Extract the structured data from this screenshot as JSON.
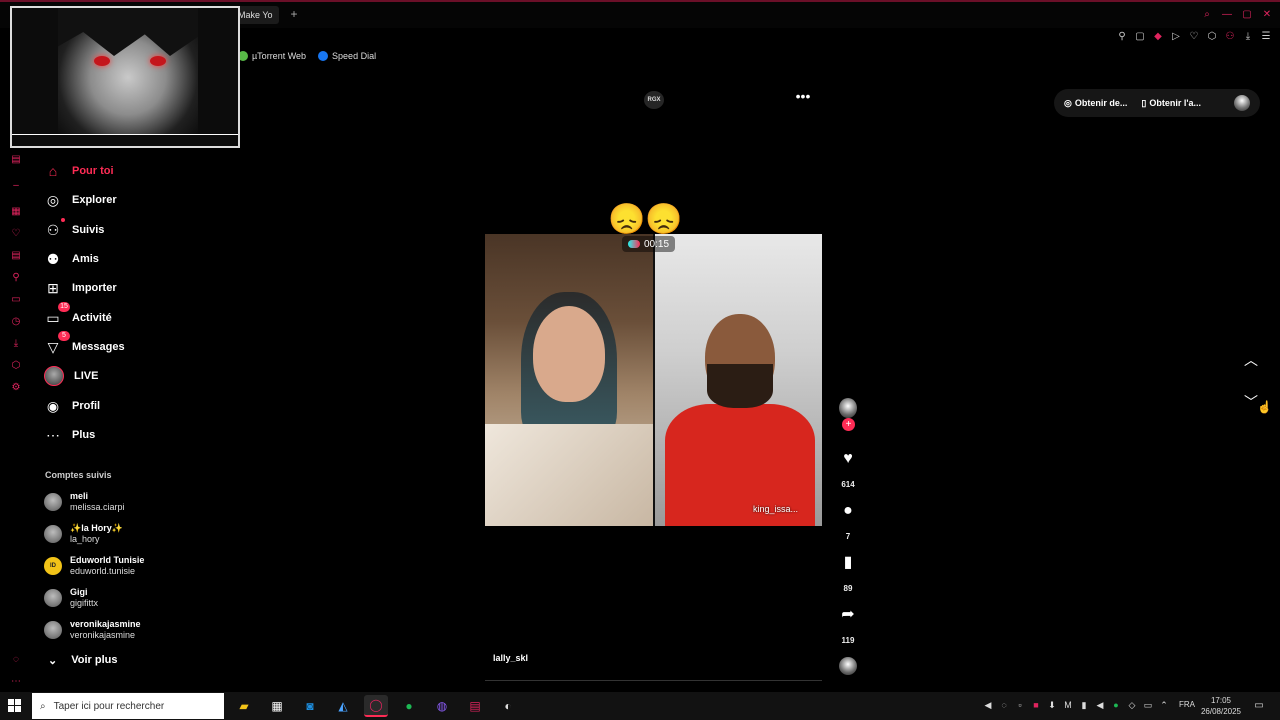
{
  "browser": {
    "tab_title": "Make Yo",
    "new_tab": "+",
    "bookmarks": [
      {
        "label": "µTorrent Web",
        "color": "#58b947"
      },
      {
        "label": "Speed Dial",
        "color": "#1877f2"
      }
    ],
    "accent_color": "#e0245e"
  },
  "sidebar": {
    "nav": [
      {
        "label": "Pour toi",
        "icon": "home-icon",
        "active": true
      },
      {
        "label": "Explorer",
        "icon": "compass-icon"
      },
      {
        "label": "Suivis",
        "icon": "following-icon"
      },
      {
        "label": "Amis",
        "icon": "friends-icon"
      },
      {
        "label": "Importer",
        "icon": "upload-icon"
      },
      {
        "label": "Activité",
        "icon": "activity-icon",
        "badge": "15"
      },
      {
        "label": "Messages",
        "icon": "messages-icon",
        "badge": "5"
      },
      {
        "label": "LIVE",
        "icon": "live-icon"
      },
      {
        "label": "Profil",
        "icon": "profile-icon"
      },
      {
        "label": "Plus",
        "icon": "more-icon"
      }
    ],
    "following_heading": "Comptes suivis",
    "accounts": [
      {
        "name": "meli",
        "handle": "melissa.ciarpi"
      },
      {
        "name": "✨la Hory✨",
        "handle": "la_hory"
      },
      {
        "name": "Eduworld Tunisie",
        "handle": "eduworld.tunisie",
        "avatar_text": "ID"
      },
      {
        "name": "Gigi",
        "handle": "gigifittx"
      },
      {
        "name": "veronikajasmine",
        "handle": "veronikajasmine"
      }
    ],
    "see_more": "Voir plus"
  },
  "header": {
    "rgx": "RGX",
    "more": "•••",
    "get_coins": "Obtenir de...",
    "get_app": "Obtenir l'a..."
  },
  "video": {
    "emoji_overlay": "😞😞",
    "timer": "00:15",
    "overlay_username": "king_issa...",
    "author": "lally_skl"
  },
  "actions": {
    "likes": "614",
    "comments": "7",
    "saves": "89",
    "shares": "119"
  },
  "taskbar": {
    "search_placeholder": "Taper ici pour rechercher",
    "language": "FRA",
    "time": "17:05",
    "date": "26/08/2025"
  }
}
